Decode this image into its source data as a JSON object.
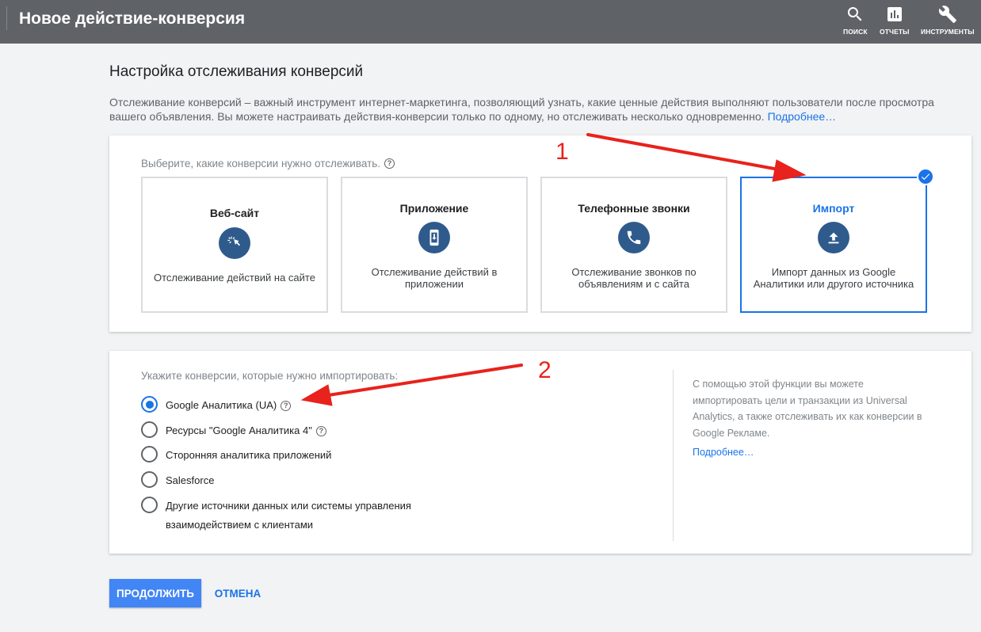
{
  "header": {
    "title": "Новое действие-конверсия",
    "tools": [
      {
        "label": "ПОИСК",
        "icon": "search-icon"
      },
      {
        "label": "ОТЧЕТЫ",
        "icon": "reports-icon"
      },
      {
        "label": "ИНСТРУМЕНТЫ",
        "icon": "wrench-icon"
      }
    ]
  },
  "page": {
    "title": "Настройка отслеживания конверсий",
    "intro": "Отслеживание конверсий – важный инструмент интернет-маркетинга, позволяющий узнать, какие ценные действия выполняют пользователи после просмотра вашего объявления. Вы можете настраивать действия-конверсии только по одному, но отслеживать несколько одновременно.",
    "intro_link": "Подробнее…"
  },
  "conversion_types": {
    "question": "Выберите, какие конверсии нужно отслеживать.",
    "selected": "Импорт",
    "options": [
      {
        "name": "Веб-сайт",
        "desc": "Отслеживание действий на сайте",
        "icon": "cursor-click-icon"
      },
      {
        "name": "Приложение",
        "desc": "Отслеживание действий в приложении",
        "icon": "phone-download-icon"
      },
      {
        "name": "Телефонные звонки",
        "desc": "Отслеживание звонков по объявлениям и с сайта",
        "icon": "phone-icon"
      },
      {
        "name": "Импорт",
        "desc": "Импорт данных из Google Аналитики или другого источника",
        "icon": "upload-icon"
      }
    ]
  },
  "import_sources": {
    "question": "Укажите конверсии, которые нужно импортировать:",
    "selected": "Google Аналитика (UA)",
    "options": [
      "Google Аналитика (UA)",
      "Ресурсы \"Google Аналитика 4\"",
      "Сторонняя аналитика приложений",
      "Salesforce",
      "Другие источники данных или системы управления взаимодействием с клиентами"
    ],
    "side_text": "С помощью этой функции вы можете импортировать цели и транзакции из Universal Analytics, а также отслеживать их как конверсии в Google Рекламе.",
    "side_link": "Подробнее…"
  },
  "actions": {
    "continue": "ПРОДОЛЖИТЬ",
    "cancel": "ОТМЕНА"
  },
  "annotations": {
    "marker_1": "1",
    "marker_2": "2",
    "arrow_color": "#e8221c"
  },
  "colors": {
    "header_bg": "#5f6368",
    "accent": "#1a73e8",
    "icon_circle": "#2f5b8c",
    "primary_button": "#4285f4"
  }
}
